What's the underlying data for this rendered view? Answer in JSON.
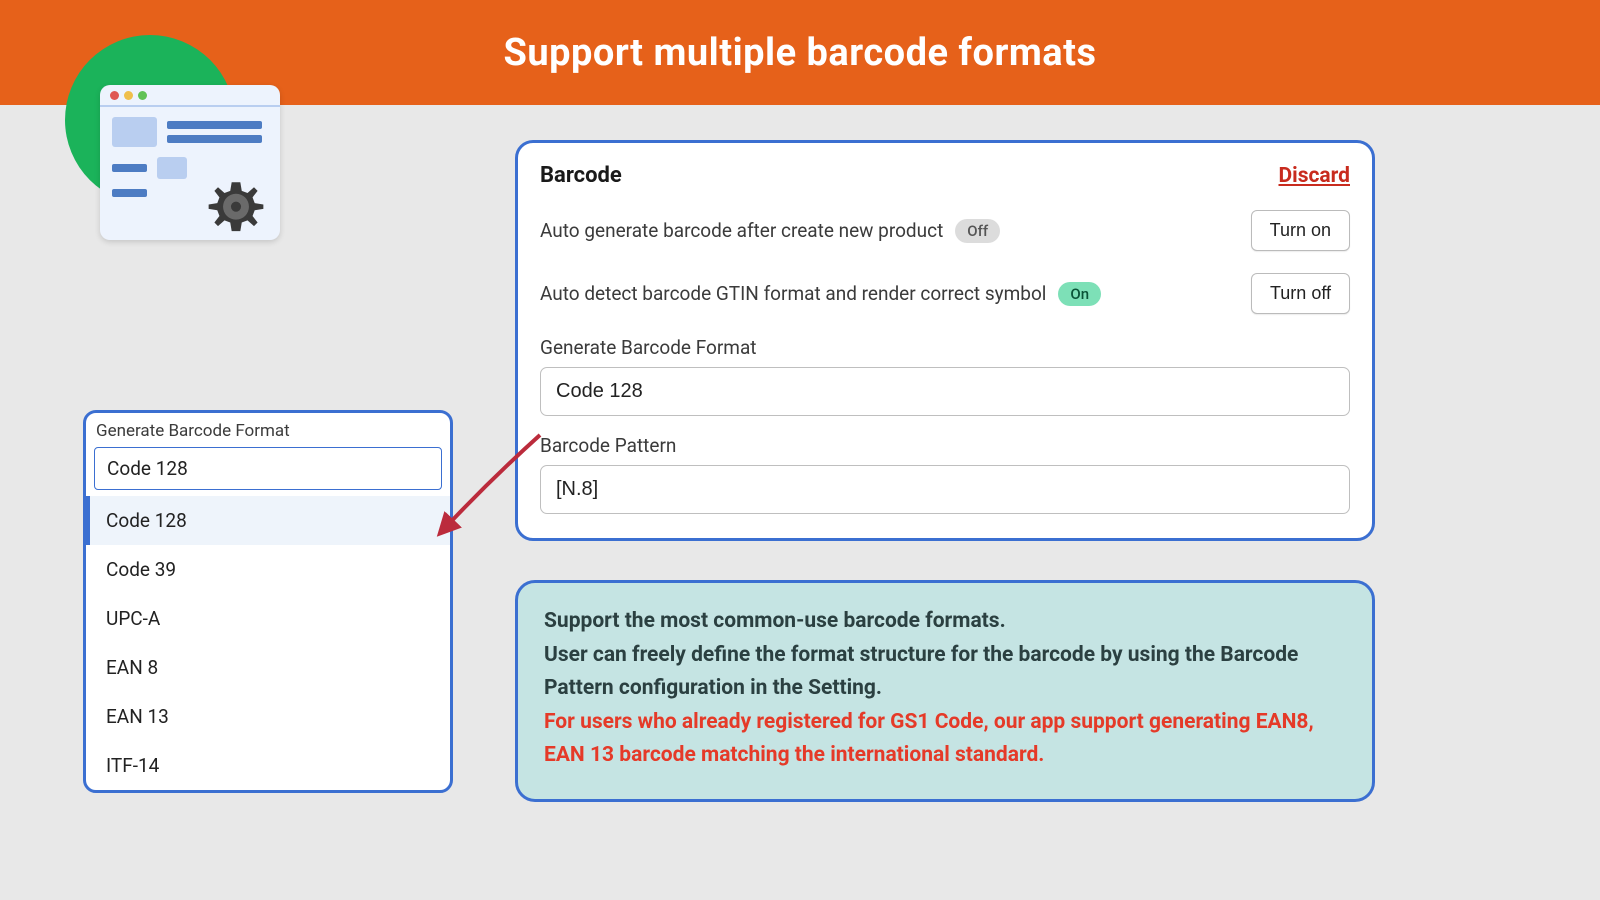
{
  "header": {
    "title": "Support multiple barcode formats"
  },
  "panel": {
    "title": "Barcode",
    "discard": "Discard",
    "row1_label": "Auto generate barcode after create new product",
    "row1_badge": "Off",
    "row1_action": "Turn on",
    "row2_label": "Auto detect barcode GTIN format and render correct symbol",
    "row2_badge": "On",
    "row2_action": "Turn off",
    "format_label": "Generate Barcode Format",
    "format_value": "Code 128",
    "pattern_label": "Barcode Pattern",
    "pattern_value": "[N.8]"
  },
  "dropdown": {
    "label": "Generate Barcode Format",
    "current": "Code 128",
    "items": [
      "Code 128",
      "Code 39",
      "UPC-A",
      "EAN 8",
      "EAN 13",
      "ITF-14"
    ]
  },
  "info": {
    "line1": "Support the most common-use barcode formats.",
    "line2": "User can freely define the format structure for the barcode by using the Barcode Pattern configuration in the Setting.",
    "line3": "For users who already registered for GS1 Code, our app support generating EAN8, EAN 13 barcode matching the international standard."
  }
}
